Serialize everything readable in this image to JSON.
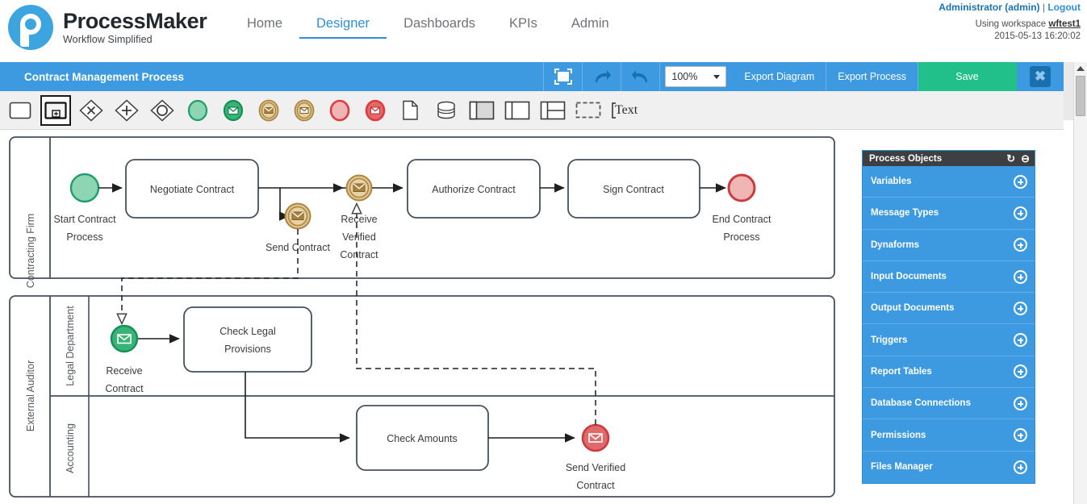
{
  "brand": {
    "name_part1": "Process",
    "name_part2": "Maker",
    "tagline": "Workflow Simplified"
  },
  "nav": {
    "items": [
      {
        "label": "Home",
        "active": false
      },
      {
        "label": "Designer",
        "active": true
      },
      {
        "label": "Dashboards",
        "active": false
      },
      {
        "label": "KPIs",
        "active": false
      },
      {
        "label": "Admin",
        "active": false
      }
    ]
  },
  "user": {
    "name": "Administrator (admin)",
    "separator": "|",
    "logout": "Logout",
    "workspace_prefix": "Using workspace",
    "workspace": "wftest1",
    "datetime": "2015-05-13 16:20:02"
  },
  "toolbar": {
    "process_title": "Contract Management Process",
    "fullscreen_icon": "fullscreen-icon",
    "redo_icon": "redo-arrow-icon",
    "undo_icon": "undo-arrow-icon",
    "zoom_value": "100%",
    "export_diagram": "Export Diagram",
    "export_process": "Export Process",
    "save": "Save",
    "close": "✖",
    "save_color": "#21c08a",
    "bar_color": "#3d9ae0"
  },
  "palette": {
    "items": [
      {
        "name": "task-shape",
        "selected": false
      },
      {
        "name": "subprocess-shape",
        "selected": true
      },
      {
        "name": "exclusive-gateway-shape",
        "selected": false
      },
      {
        "name": "parallel-gateway-shape",
        "selected": false
      },
      {
        "name": "inclusive-gateway-shape",
        "selected": false
      },
      {
        "name": "start-event-shape",
        "selected": false
      },
      {
        "name": "start-message-event-shape",
        "selected": false
      },
      {
        "name": "intermediate-message-catch-event-shape",
        "selected": false
      },
      {
        "name": "intermediate-message-throw-event-shape",
        "selected": false
      },
      {
        "name": "end-event-shape",
        "selected": false
      },
      {
        "name": "end-message-event-shape",
        "selected": false
      },
      {
        "name": "data-object-shape",
        "selected": false
      },
      {
        "name": "data-store-shape",
        "selected": false
      },
      {
        "name": "pool-horizontal-shape",
        "selected": false
      },
      {
        "name": "lane-shape",
        "selected": false
      },
      {
        "name": "pool-multi-lane-shape",
        "selected": false
      },
      {
        "name": "group-shape",
        "selected": false
      }
    ],
    "text_label": "Text"
  },
  "process_objects": {
    "title": "Process Objects",
    "refresh_icon": "refresh-icon",
    "collapse_icon": "minus-circle-icon",
    "items": [
      {
        "label": "Variables"
      },
      {
        "label": "Message Types"
      },
      {
        "label": "Dynaforms"
      },
      {
        "label": "Input Documents"
      },
      {
        "label": "Output Documents"
      },
      {
        "label": "Triggers"
      },
      {
        "label": "Report Tables"
      },
      {
        "label": "Database Connections"
      },
      {
        "label": "Permissions"
      },
      {
        "label": "Files Manager"
      }
    ]
  },
  "diagram": {
    "pools": [
      {
        "name": "Contracting Firm",
        "lanes": []
      },
      {
        "name": "External Auditor",
        "lanes": [
          {
            "name": "Legal Department"
          },
          {
            "name": "Accounting"
          }
        ]
      }
    ],
    "nodes": {
      "start_contract_process": "Start Contract\nProcess",
      "start_contract_process_line1": "Start Contract",
      "start_contract_process_line2": "Process",
      "negotiate_contract": "Negotiate Contract",
      "send_contract": "Send Contract",
      "receive_verified_contract_line1": "Receive",
      "receive_verified_contract_line2": "Verified",
      "receive_verified_contract_line3": "Contract",
      "authorize_contract": "Authorize Contract",
      "sign_contract": "Sign Contract",
      "end_contract_process_line1": "End Contract",
      "end_contract_process_line2": "Process",
      "receive_contract_line1": "Receive",
      "receive_contract_line2": "Contract",
      "check_legal_provisions_line1": "Check Legal",
      "check_legal_provisions_line2": "Provisions",
      "check_amounts": "Check Amounts",
      "send_verified_contract_line1": "Send Verified",
      "send_verified_contract_line2": "Contract"
    },
    "colors": {
      "start_event_fill": "#8ed6b3",
      "start_event_stroke": "#1e9e6a",
      "message_event_fill": "#e0c48f",
      "message_event_stroke": "#ab8742",
      "green_message_fill": "#39b377",
      "green_message_stroke": "#139155",
      "end_event_fill": "#f0b6b6",
      "end_event_stroke": "#cc3b40",
      "red_message_fill": "#e06a6a",
      "red_message_stroke": "#cc3b40",
      "shape_stroke": "#44505e"
    }
  }
}
